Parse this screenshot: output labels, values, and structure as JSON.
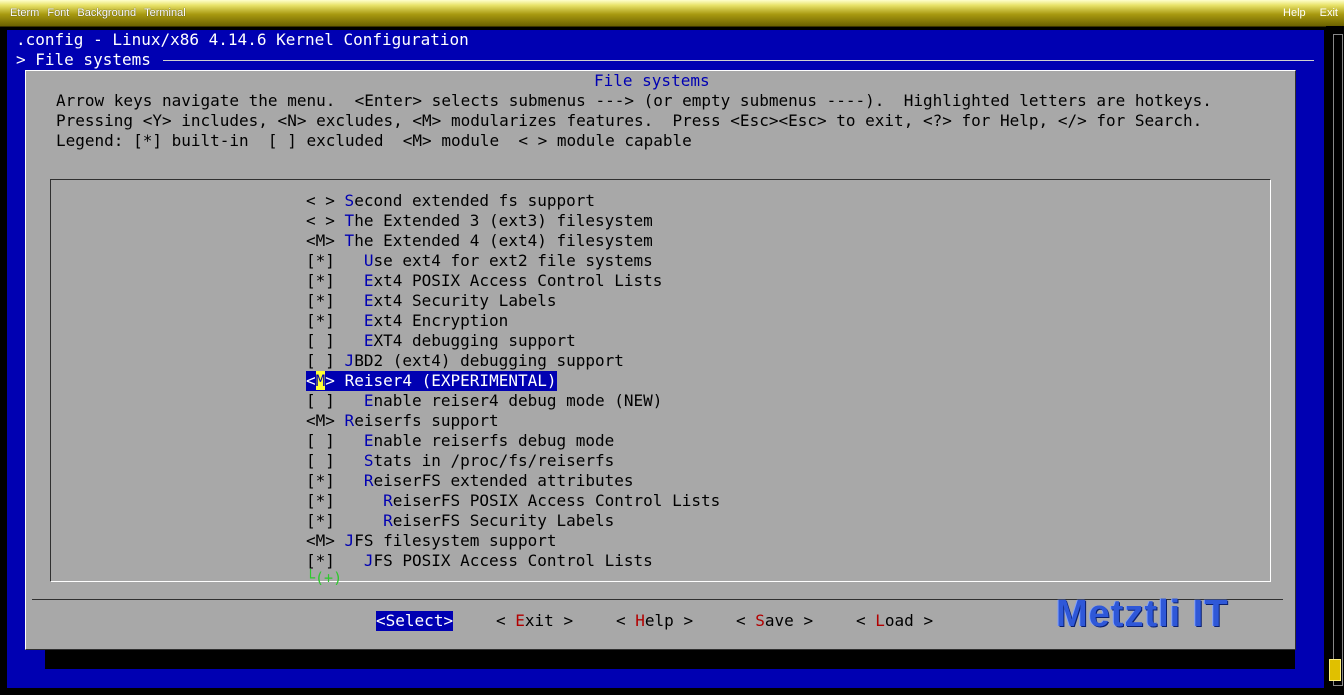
{
  "window": {
    "menu": [
      "Eterm",
      "Font",
      "Background",
      "Terminal"
    ],
    "right": [
      "Help",
      "Exit"
    ]
  },
  "header": {
    "title": ".config - Linux/x86 4.14.6 Kernel Configuration",
    "breadcrumb": "> File systems"
  },
  "dialog": {
    "title": "File systems",
    "help": [
      "Arrow keys navigate the menu.  <Enter> selects submenus ---> (or empty submenus ----).  Highlighted letters are hotkeys.",
      "Pressing <Y> includes, <N> excludes, <M> modularizes features.  Press <Esc><Esc> to exit, <?> for Help, </> for Search.",
      "Legend: [*] built-in  [ ] excluded  <M> module  < > module capable"
    ]
  },
  "menu": {
    "items": [
      {
        "state": "< >",
        "indent": "",
        "hk": "S",
        "rest": "econd extended fs support"
      },
      {
        "state": "< >",
        "indent": "",
        "hk": "T",
        "rest": "he Extended 3 (ext3) filesystem"
      },
      {
        "state": "<M>",
        "indent": "",
        "hk": "T",
        "rest": "he Extended 4 (ext4) filesystem"
      },
      {
        "state": "[*]",
        "indent": "  ",
        "hk": "U",
        "rest": "se ext4 for ext2 file systems"
      },
      {
        "state": "[*]",
        "indent": "  ",
        "hk": "E",
        "rest": "xt4 POSIX Access Control Lists"
      },
      {
        "state": "[*]",
        "indent": "  ",
        "hk": "E",
        "rest": "xt4 Security Labels"
      },
      {
        "state": "[*]",
        "indent": "  ",
        "hk": "E",
        "rest": "xt4 Encryption"
      },
      {
        "state": "[ ]",
        "indent": "  ",
        "hk": "E",
        "rest": "XT4 debugging support"
      },
      {
        "state": "[ ]",
        "indent": "",
        "hk": "J",
        "rest": "BD2 (ext4) debugging support"
      },
      {
        "state": "<M>",
        "indent": "",
        "hk": "R",
        "rest": "eiser4 (EXPERIMENTAL)",
        "selected": true
      },
      {
        "state": "[ ]",
        "indent": "  ",
        "hk": "E",
        "rest": "nable reiser4 debug mode (NEW)"
      },
      {
        "state": "<M>",
        "indent": "",
        "hk": "R",
        "rest": "eiserfs support"
      },
      {
        "state": "[ ]",
        "indent": "  ",
        "hk": "E",
        "rest": "nable reiserfs debug mode"
      },
      {
        "state": "[ ]",
        "indent": "  ",
        "hk": "S",
        "rest": "tats in /proc/fs/reiserfs"
      },
      {
        "state": "[*]",
        "indent": "  ",
        "hk": "R",
        "rest": "eiserFS extended attributes"
      },
      {
        "state": "[*]",
        "indent": "    ",
        "hk": "R",
        "rest": "eiserFS POSIX Access Control Lists"
      },
      {
        "state": "[*]",
        "indent": "    ",
        "hk": "R",
        "rest": "eiserFS Security Labels"
      },
      {
        "state": "<M>",
        "indent": "",
        "hk": "J",
        "rest": "FS filesystem support"
      },
      {
        "state": "[*]",
        "indent": "  ",
        "hk": "J",
        "rest": "FS POSIX Access Control Lists"
      }
    ],
    "more_indicator": "└(+)"
  },
  "buttons": [
    {
      "pre": "<",
      "hk": "S",
      "rest": "elect>",
      "active": true,
      "id": "select"
    },
    {
      "pre": "< ",
      "hk": "E",
      "rest": "xit >",
      "id": "exit"
    },
    {
      "pre": "< ",
      "hk": "H",
      "rest": "elp >",
      "id": "help"
    },
    {
      "pre": "< ",
      "hk": "S",
      "rest": "ave >",
      "id": "save"
    },
    {
      "pre": "< ",
      "hk": "L",
      "rest": "oad >",
      "id": "load"
    }
  ],
  "watermark": "Metztli IT",
  "colors": {
    "terminal_bg": "#0000b2",
    "dialog_bg": "#a8a8a8",
    "hotkey": "#0000b2",
    "button_hotkey": "#b20000",
    "cursor": "#ffff33"
  }
}
